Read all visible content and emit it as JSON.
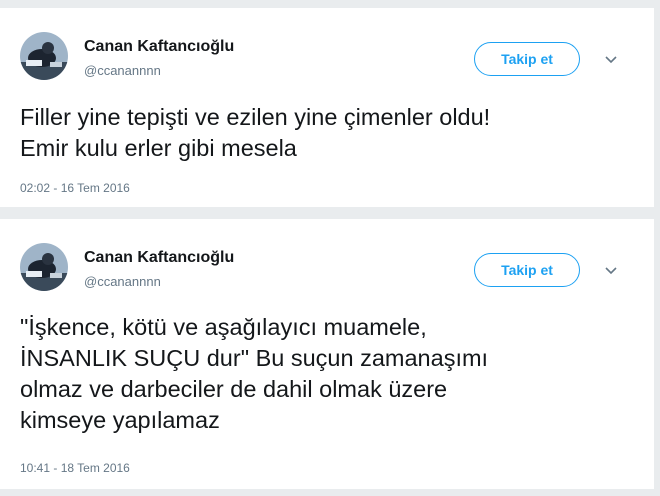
{
  "tweets": [
    {
      "display_name": "Canan Kaftancıoğlu",
      "handle": "@ccanannnn",
      "follow_label": "Takip et",
      "text": "Filler yine tepişti ve ezilen yine çimenler oldu!\nEmir kulu erler gibi mesela",
      "timestamp": "02:02 - 16 Tem 2016"
    },
    {
      "display_name": "Canan Kaftancıoğlu",
      "handle": "@ccanannnn",
      "follow_label": "Takip et",
      "text": "\"İşkence, kötü ve aşağılayıcı muamele,\nİNSANLIK SUÇU dur\" Bu suçun zamanaşımı\nolmaz ve darbeciler de dahil olmak üzere\nkimseye yapılamaz",
      "timestamp": "10:41 - 18 Tem 2016"
    }
  ],
  "colors": {
    "accent": "#1da1f2",
    "text_primary": "#14171a",
    "text_secondary": "#657786",
    "background": "#e9ecee"
  },
  "icons": {
    "menu": "chevron-down-icon",
    "avatar": "avatar"
  }
}
